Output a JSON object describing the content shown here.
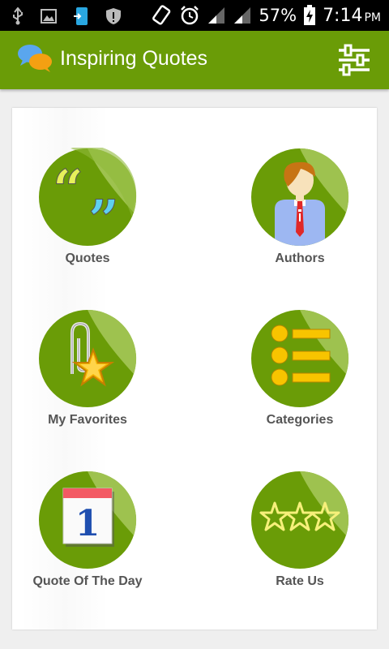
{
  "status_bar": {
    "battery_percent": "57%",
    "time": "7:14",
    "ampm": "PM",
    "icons": [
      "usb-icon",
      "image-icon",
      "download-icon",
      "shield-icon",
      "screen-rotation-icon",
      "alarm-icon",
      "signal-icon",
      "signal-icon",
      "battery-icon"
    ]
  },
  "app_bar": {
    "title": "Inspiring Quotes",
    "color": "#6a9c07",
    "icons": [
      "chat-bubbles-logo-icon",
      "settings-sliders-icon"
    ]
  },
  "menu": {
    "items": [
      {
        "label": "Quotes",
        "icon": "quotes-icon"
      },
      {
        "label": "Authors",
        "icon": "author-icon"
      },
      {
        "label": "My Favorites",
        "icon": "favorites-icon"
      },
      {
        "label": "Categories",
        "icon": "categories-icon"
      },
      {
        "label": "Quote Of The Day",
        "icon": "calendar-icon"
      },
      {
        "label": "Rate Us",
        "icon": "stars-icon"
      }
    ],
    "calendar_day": "1",
    "disc_color": "#6a9c07",
    "label_color": "#555555"
  }
}
